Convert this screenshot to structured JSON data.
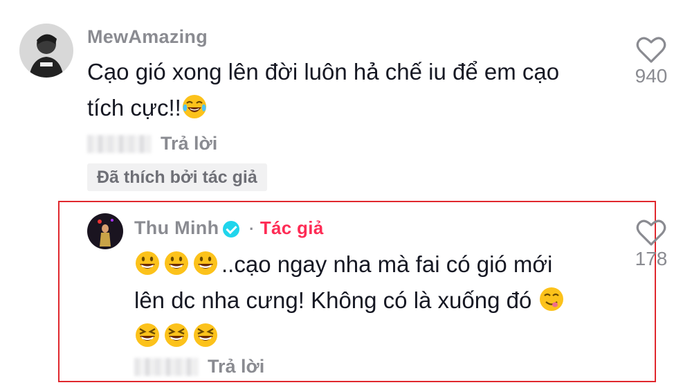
{
  "comment": {
    "username": "MewAmazing",
    "text_line1": "Cạo gió xong lên đời luôn hả chế iu để em cạo",
    "text_line2": "tích cực!!",
    "reply_label": "Trả lời",
    "liked_by_author": "Đã thích bởi tác giả",
    "like_count": "940",
    "emoji_end": "face-with-tears-of-joy"
  },
  "reply": {
    "username": "Thu Minh",
    "separator": "·",
    "author_label": "Tác giả",
    "text_line1": "..cạo ngay nha mà fai có gió mới",
    "text_line2": "lên dc nha cưng! Không có là xuống đó",
    "reply_label": "Trả lời",
    "like_count": "178",
    "emojis_line1": [
      "grinning-face",
      "grinning-face",
      "grinning-face"
    ],
    "emoji_line2_end": "face-savoring-food",
    "emojis_line3": [
      "grinning-squinting-face",
      "grinning-squinting-face",
      "grinning-squinting-face"
    ]
  },
  "colors": {
    "highlight_border": "#e0272d",
    "author_tag": "#fe2c55",
    "verified": "#20d5ec",
    "muted_text": "#8a8b91"
  }
}
